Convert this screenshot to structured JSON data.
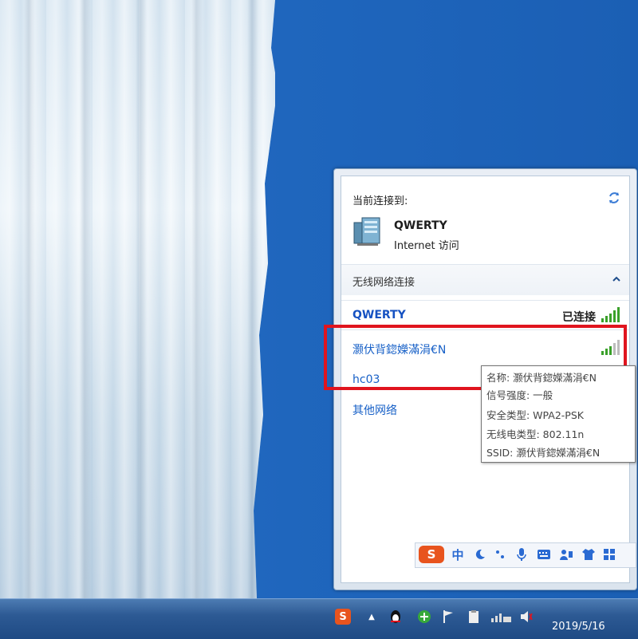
{
  "flyout": {
    "connected_label": "当前连接到:",
    "current_network": {
      "name": "QWERTY",
      "access": "Internet 访问"
    },
    "section_title": "无线网络连接",
    "networks": [
      {
        "name": "QWERTY",
        "status": "已连接",
        "signal_bars": 5
      },
      {
        "name": "灏伏背鍃嬫滿涓€N",
        "status": "",
        "signal_bars": 3
      },
      {
        "name": "hc03",
        "status": "",
        "signal_bars": 2
      }
    ],
    "other_networks": "其他网络"
  },
  "tooltip": {
    "name_line": "名称: 灏伏背鍃嬫滿涓€N",
    "signal_line": "信号强度: 一般",
    "security_line": "安全类型: WPA2-PSK",
    "radio_line": "无线电类型: 802.11n",
    "ssid_line": "SSID: 灏伏背鍃嬫滿涓€N"
  },
  "ime": {
    "logo": "S",
    "mode": "中"
  },
  "taskbar": {
    "clock_date": "2019/5/16",
    "ime_logo": "S"
  },
  "colors": {
    "highlight": "#e0141e",
    "link": "#1760c7",
    "signal": "#3aa02a"
  }
}
